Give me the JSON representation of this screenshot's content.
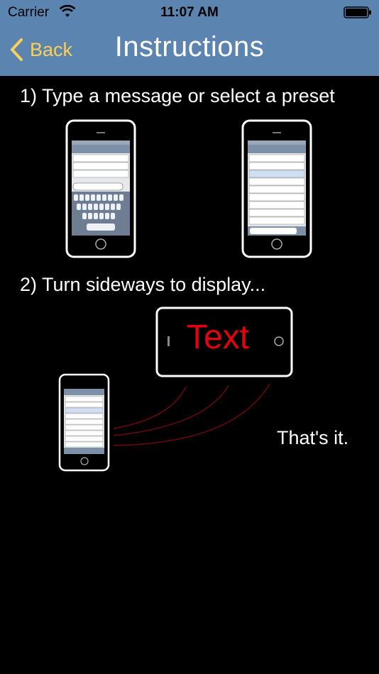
{
  "status_bar": {
    "carrier": "Carrier",
    "time": "11:07 AM",
    "icons": [
      "wifi-icon",
      "battery-icon"
    ]
  },
  "nav": {
    "back_label": "Back",
    "title": "Instructions",
    "colors": {
      "bar": "#5b84b1",
      "back": "#f7d15b",
      "title": "#ffffff"
    }
  },
  "content": {
    "step1": "1) Type a message or select a preset",
    "step2": "2) Turn sideways to display...",
    "display_text": "Text",
    "closing": "That's it."
  }
}
